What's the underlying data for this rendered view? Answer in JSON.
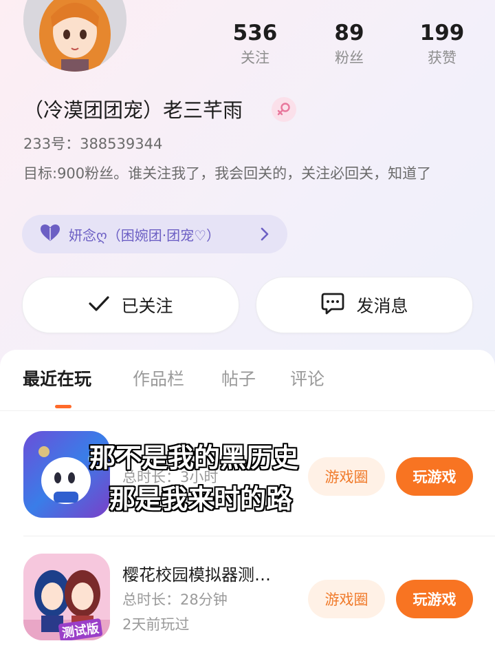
{
  "profile": {
    "nickname": "（冷漠团团宠）老三芊雨",
    "uid": "233号：388539344",
    "bio": "目标:900粉丝。谁关注我了，我会回关的，关注必回关，知道了",
    "group": "妍念ღ（困婉团·团宠♡）"
  },
  "stats": [
    {
      "value": "536",
      "label": "关注"
    },
    {
      "value": "89",
      "label": "粉丝"
    },
    {
      "value": "199",
      "label": "获赞"
    }
  ],
  "actions": {
    "follow_label": "已关注",
    "message_label": "发消息"
  },
  "tabs": [
    "最近在玩",
    "作品栏",
    "帖子",
    "评论"
  ],
  "games": [
    {
      "title": "",
      "meta1": "总时长：3小时",
      "meta2": "",
      "circle_label": "游戏圈",
      "play_label": "玩游戏"
    },
    {
      "title": "樱花校园模拟器测…",
      "meta1": "总时长：28分钟",
      "meta2": "2天前玩过",
      "circle_label": "游戏圈",
      "play_label": "玩游戏",
      "icon_badge": "测试版"
    }
  ],
  "subtitles": [
    "那不是我的黑历史",
    "那是我来时的路"
  ],
  "icons": {
    "gender": "female-icon",
    "group": "heart-icon",
    "follow": "check-icon",
    "message": "chat-icon"
  },
  "colors": {
    "accent": "#f87422",
    "group_text": "#6c5fc4",
    "gender": "#e8779c"
  }
}
